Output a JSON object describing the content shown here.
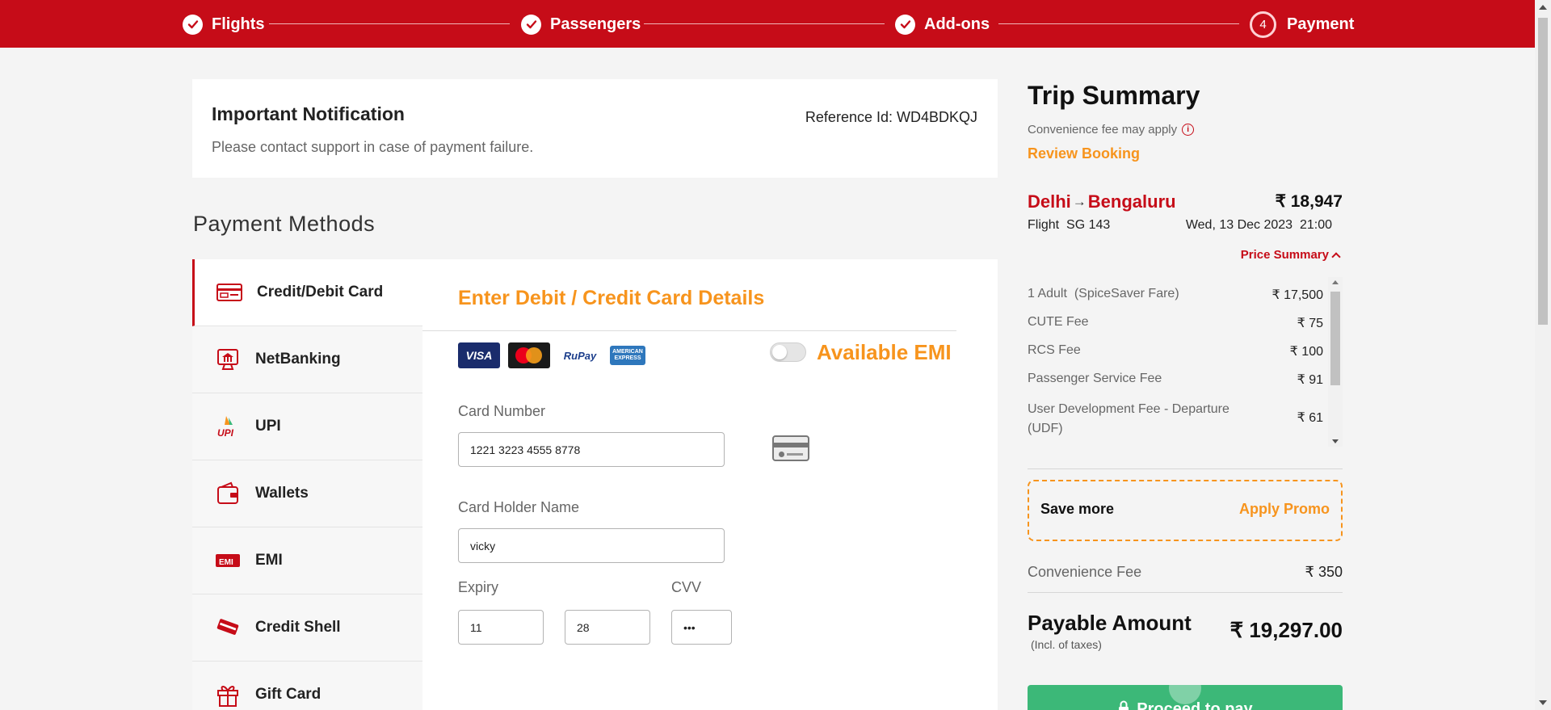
{
  "stepper": {
    "steps": [
      {
        "label": "Flights",
        "state": "done"
      },
      {
        "label": "Passengers",
        "state": "done"
      },
      {
        "label": "Add-ons",
        "state": "done"
      },
      {
        "label": "Payment",
        "state": "current",
        "number": "4"
      }
    ]
  },
  "notification": {
    "title": "Important Notification",
    "message": "Please contact support in case of payment failure.",
    "reference": "Reference Id: WD4BDKQJ"
  },
  "payment_methods": {
    "title": "Payment Methods",
    "items": [
      {
        "label": "Credit/Debit Card",
        "icon": "credit-card-icon",
        "active": true
      },
      {
        "label": "NetBanking",
        "icon": "bank-icon",
        "active": false
      },
      {
        "label": "UPI",
        "icon": "upi-icon",
        "active": false
      },
      {
        "label": "Wallets",
        "icon": "wallet-icon",
        "active": false
      },
      {
        "label": "EMI",
        "icon": "emi-icon",
        "active": false
      },
      {
        "label": "Credit Shell",
        "icon": "credit-shell-icon",
        "active": false
      },
      {
        "label": "Gift Card",
        "icon": "gift-icon",
        "active": false
      }
    ]
  },
  "card_form": {
    "title": "Enter Debit / Credit Card Details",
    "logos": {
      "visa": "VISA",
      "mastercard": "MasterCard",
      "rupay": "RuPay",
      "amex": "AMERICAN EXPRESS"
    },
    "emi_label": "Available EMI",
    "card_number_label": "Card Number",
    "card_number_value": "1221 3223 4555 8778",
    "holder_label": "Card Holder Name",
    "holder_value": "vicky",
    "expiry_label": "Expiry",
    "expiry_month": "11",
    "expiry_year": "28",
    "cvv_label": "CVV",
    "cvv_value": "•••"
  },
  "summary": {
    "title": "Trip Summary",
    "convenience_note": "Convenience fee may apply",
    "review_link": "Review Booking",
    "origin": "Delhi",
    "arrow": "→",
    "destination": "Bengaluru",
    "trip_price": "₹ 18,947",
    "flight": "Flight  SG 143",
    "date": "Wed, 13 Dec 2023  21:00",
    "price_summary_label": "Price Summary",
    "price_rows": [
      {
        "label": "1 Adult  (SpiceSaver Fare)",
        "value": "₹ 17,500"
      },
      {
        "label": "CUTE Fee",
        "value": "₹ 75"
      },
      {
        "label": "RCS Fee",
        "value": "₹ 100"
      },
      {
        "label": "Passenger Service Fee",
        "value": "₹ 91"
      },
      {
        "label": "User Development Fee - Departure (UDF)",
        "value": "₹ 61"
      }
    ],
    "promo_save": "Save more",
    "promo_apply": "Apply Promo",
    "convenience_fee_label": "Convenience Fee",
    "convenience_fee_value": "₹ 350",
    "payable_label": "Payable Amount",
    "payable_note": "(Incl. of taxes)",
    "payable_value": "₹ 19,297.00",
    "pay_button": "Proceed to pay"
  },
  "colors": {
    "brand_red": "#c60c18",
    "accent_orange": "#f7941d",
    "pay_green": "#3cb878"
  }
}
